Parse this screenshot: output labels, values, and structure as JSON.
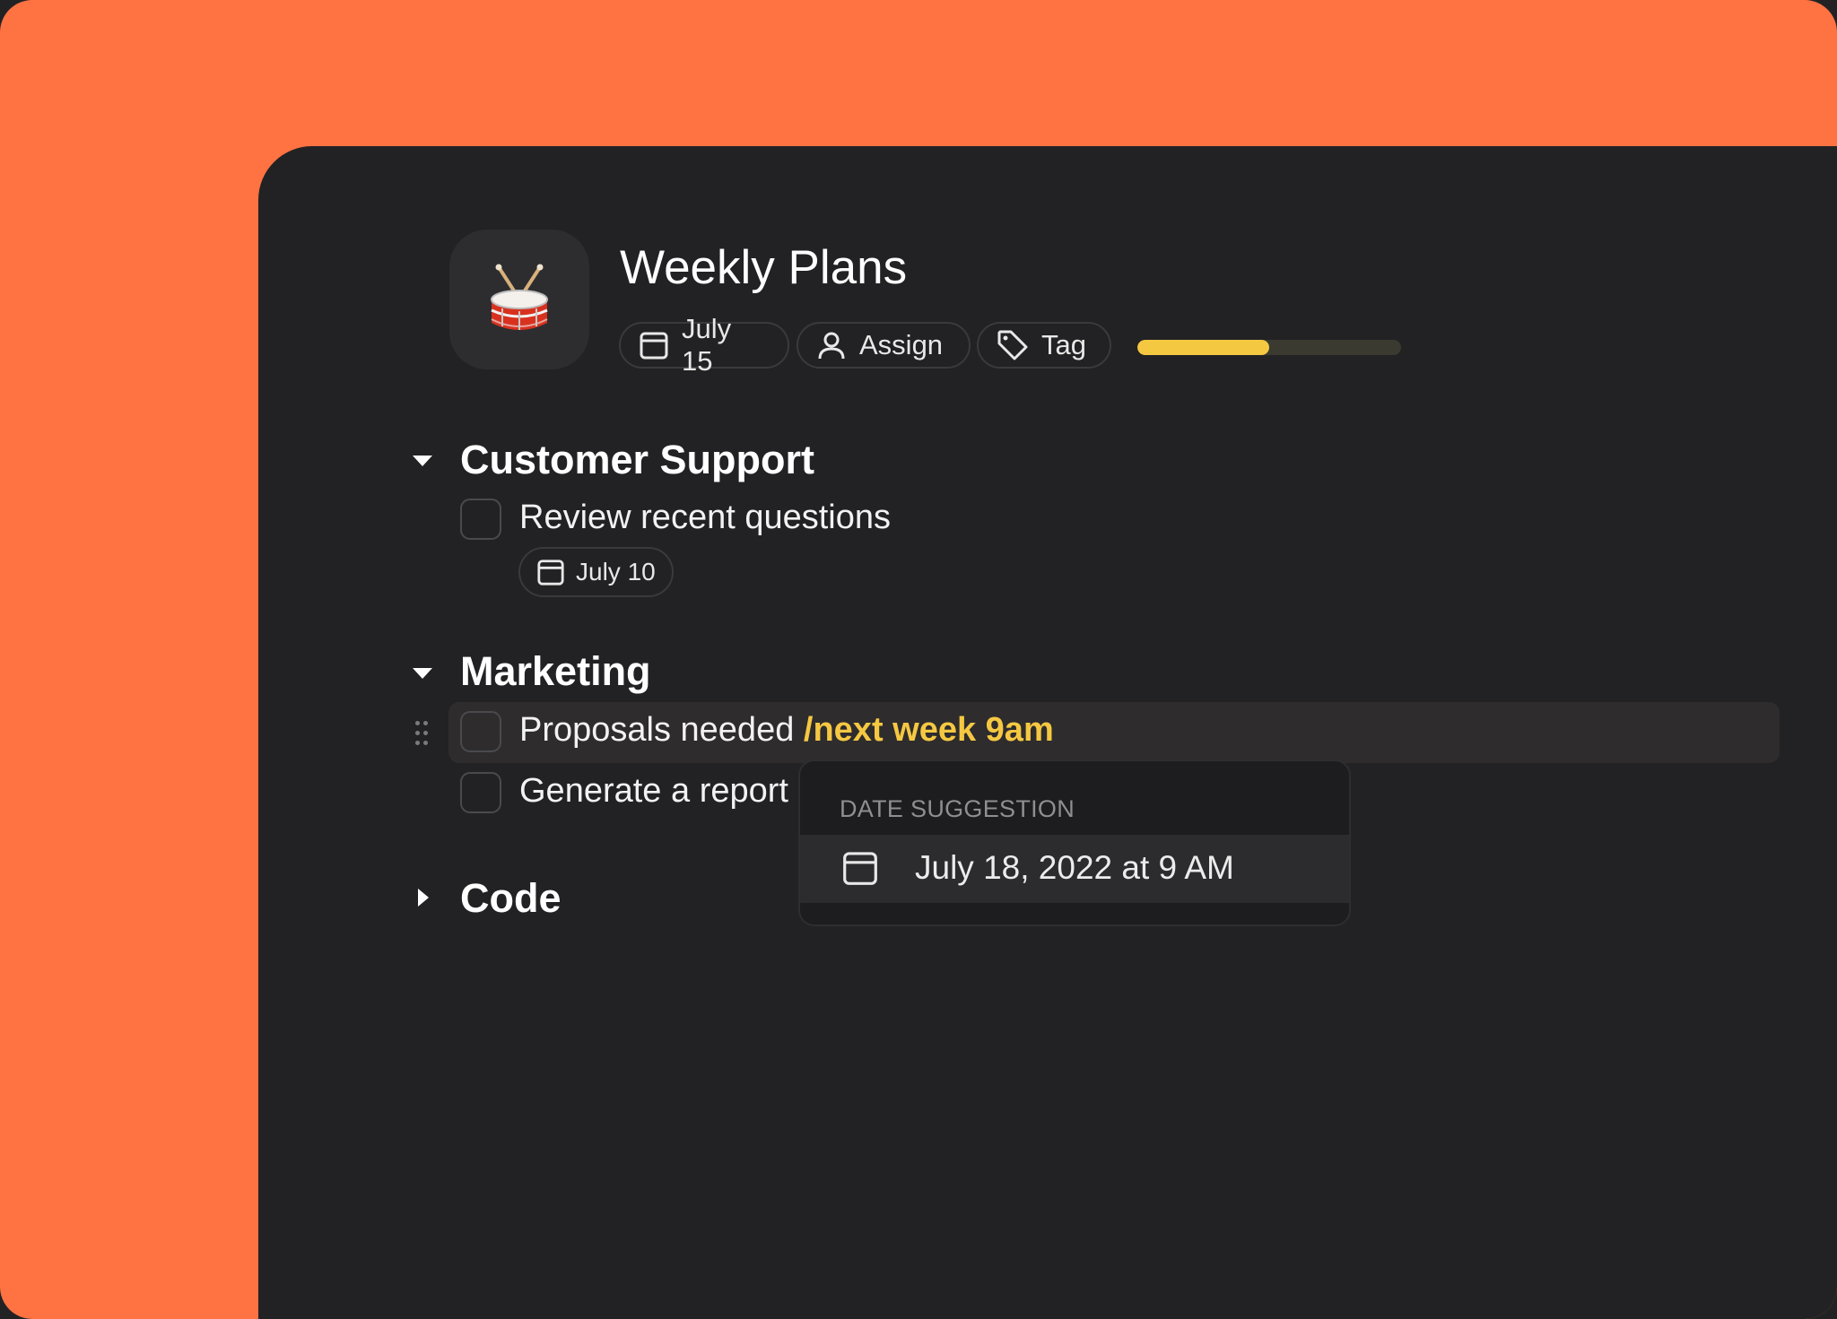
{
  "page": {
    "title": "Weekly Plans",
    "icon": "drum-emoji",
    "chips": {
      "date": "July 15",
      "assign": "Assign",
      "tag": "Tag"
    },
    "progress": 0.5
  },
  "sections": [
    {
      "title": "Customer Support",
      "expanded": true,
      "tasks": [
        {
          "text": "Review recent questions",
          "due": "July 10"
        }
      ]
    },
    {
      "title": "Marketing",
      "expanded": true,
      "tasks": [
        {
          "text": "Proposals needed ",
          "command": "/next week 9am"
        },
        {
          "text": "Generate a report"
        }
      ]
    },
    {
      "title": "Code",
      "expanded": false,
      "tasks": []
    }
  ],
  "popup": {
    "header": "DATE SUGGESTION",
    "suggestion": "July 18, 2022 at 9 AM"
  },
  "colors": {
    "background": "#ff7242",
    "panel": "#222224",
    "accent": "#f5c842"
  }
}
